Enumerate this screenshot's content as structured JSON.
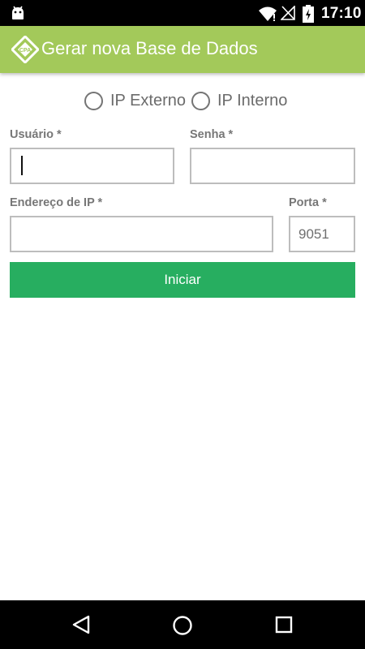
{
  "status_bar": {
    "time": "17:10",
    "icons": [
      "android-icon",
      "wifi-icon",
      "signal-icon",
      "battery-icon"
    ]
  },
  "app_bar": {
    "title": "Gerar nova Base de Dados",
    "logo_icon": "cpa-logo-icon",
    "background_color": "#a3c95a"
  },
  "radio_group": {
    "options": [
      {
        "label": "IP Externo",
        "selected": false
      },
      {
        "label": "IP Interno",
        "selected": false
      }
    ]
  },
  "form": {
    "usuario": {
      "label": "Usuário *",
      "value": ""
    },
    "senha": {
      "label": "Senha *",
      "value": ""
    },
    "endereco_ip": {
      "label": "Endereço de IP *",
      "value": ""
    },
    "porta": {
      "label": "Porta *",
      "value": "9051"
    }
  },
  "start_button": {
    "label": "Iniciar",
    "color": "#27ae60"
  },
  "nav_bar": {
    "icons": [
      "back-icon",
      "home-icon",
      "recents-icon"
    ]
  }
}
